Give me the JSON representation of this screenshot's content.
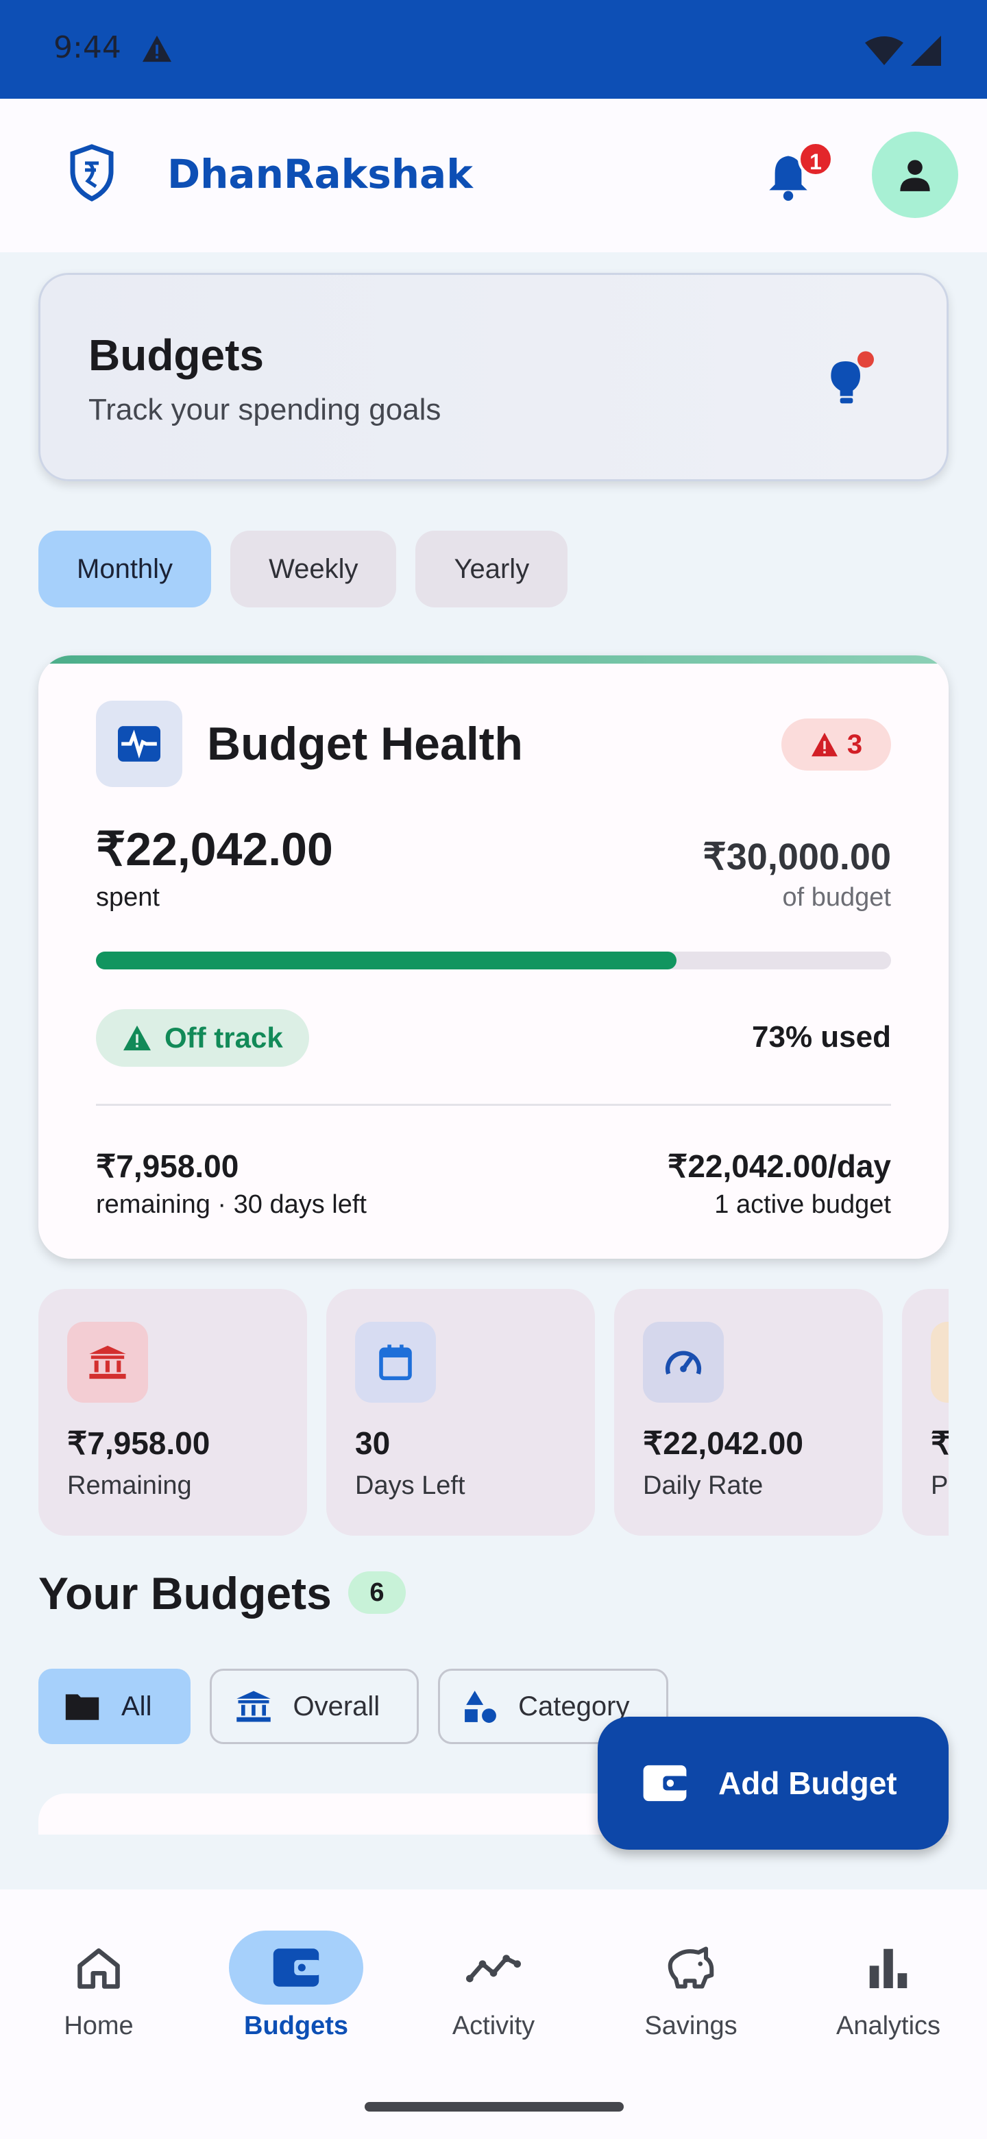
{
  "status_bar": {
    "time": "9:44"
  },
  "app_bar": {
    "title": "DhanRakshak",
    "notification_count": "1"
  },
  "header": {
    "title": "Budgets",
    "subtitle": "Track your spending goals"
  },
  "period_tabs": [
    "Monthly",
    "Weekly",
    "Yearly"
  ],
  "health": {
    "title": "Budget Health",
    "alert_count": "3",
    "spent_amount": "₹22,042.00",
    "spent_label": "spent",
    "budget_amount": "₹30,000.00",
    "budget_label": "of budget",
    "progress_fraction": 0.73,
    "status": "Off track",
    "used": "73% used",
    "remaining_amount": "₹7,958.00",
    "remaining_label": "remaining · 30 days left",
    "daily_rate": "₹22,042.00/day",
    "active_budgets": "1 active budget"
  },
  "stats": [
    {
      "value": "₹7,958.00",
      "label": "Remaining",
      "icon": "bank-icon",
      "color": "#d32f2f"
    },
    {
      "value": "30",
      "label": "Days Left",
      "icon": "calendar-icon",
      "color": "#1e6fd9"
    },
    {
      "value": "₹22,042.00",
      "label": "Daily Rate",
      "icon": "speedometer-icon",
      "color": "#1a4fb0"
    },
    {
      "value": "₹",
      "label": "P",
      "icon": "partial-icon",
      "color": "#e0a050"
    }
  ],
  "budgets_section": {
    "title": "Your Budgets",
    "count": "6"
  },
  "filter_chips": [
    "All",
    "Overall",
    "Category"
  ],
  "fab": {
    "label": "Add Budget"
  },
  "bottom_nav": [
    "Home",
    "Budgets",
    "Activity",
    "Savings",
    "Analytics"
  ],
  "colors": {
    "primary": "#0d4fb5",
    "success": "#11955f",
    "danger": "#d21f26"
  }
}
